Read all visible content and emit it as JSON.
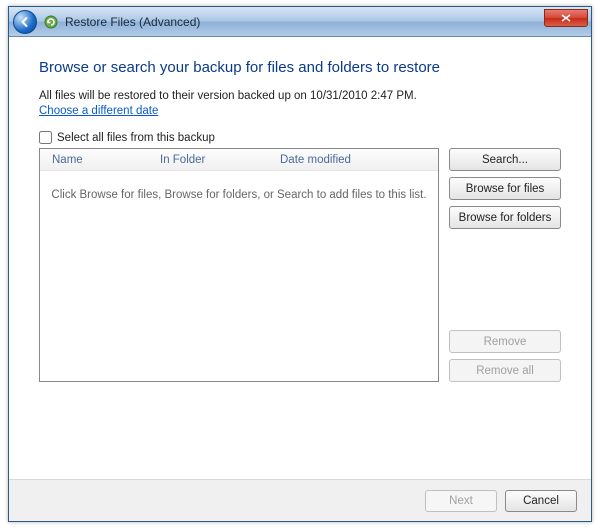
{
  "window": {
    "title": "Restore Files (Advanced)"
  },
  "heading": "Browse or search your backup for files and folders to restore",
  "info_text": "All files will be restored to their version backed up on 10/31/2010 2:47 PM.",
  "link_text": "Choose a different date",
  "select_all_label": "Select all files from this backup",
  "columns": {
    "name": "Name",
    "folder": "In Folder",
    "date": "Date modified"
  },
  "empty_message": "Click Browse for files, Browse for folders, or Search to add files to this list.",
  "buttons": {
    "search": "Search...",
    "browse_files": "Browse for files",
    "browse_folders": "Browse for folders",
    "remove": "Remove",
    "remove_all": "Remove all",
    "next": "Next",
    "cancel": "Cancel"
  }
}
